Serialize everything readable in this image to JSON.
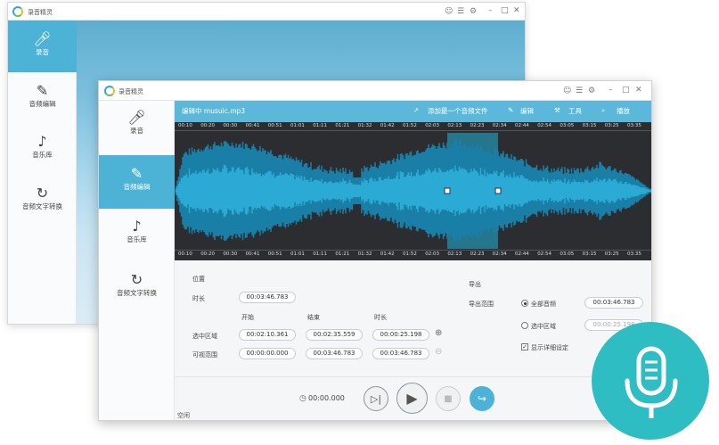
{
  "app": {
    "title": "录音精灵"
  },
  "back_window": {
    "sidebar": [
      {
        "label": "录音",
        "icon": "microphone-icon"
      },
      {
        "label": "音频编辑",
        "icon": "pencil-icon"
      },
      {
        "label": "音乐库",
        "icon": "music-list-icon"
      },
      {
        "label": "音频文字转换",
        "icon": "convert-icon"
      }
    ]
  },
  "sidebar": [
    {
      "label": "录音",
      "icon": "microphone-icon"
    },
    {
      "label": "音频编辑",
      "icon": "pencil-icon"
    },
    {
      "label": "音乐库",
      "icon": "music-list-icon"
    },
    {
      "label": "音频文字转换",
      "icon": "convert-icon"
    }
  ],
  "toolbar": {
    "file_label": "编辑中 musuic.mp3",
    "add_file": "添加最一个音频文件",
    "edit": "编辑",
    "tools": "工具",
    "playback": "播放"
  },
  "ruler_ticks": [
    "00:10",
    "00:20",
    "00:30",
    "00:41",
    "00:51",
    "01:01",
    "01:11",
    "01:21",
    "01:32",
    "01:42",
    "01:52",
    "02:03",
    "02:13",
    "02:23",
    "02:34",
    "02:44",
    "02:54",
    "03:05",
    "03:15",
    "03:25",
    "03:35"
  ],
  "position": {
    "label": "位置"
  },
  "duration": {
    "label": "时长",
    "value": "00:03:46.783"
  },
  "columns": {
    "start": "开始",
    "end": "结束",
    "length": "时长"
  },
  "selected_range": {
    "label": "选中区域",
    "start": "00:02:10.361",
    "end": "00:02:35.559",
    "length": "00:00:25.198"
  },
  "visible_range": {
    "label": "可视范围",
    "start": "00:00:00.000",
    "end": "00:03:46.783",
    "length": "00:03:46.783"
  },
  "export": {
    "label": "导出",
    "range_label": "导出范围",
    "all_audio": "全部音频",
    "all_value": "00:03:46.783",
    "selected_area": "选中区域",
    "selected_value": "00:00:25.198",
    "show_details": "显示详细设定"
  },
  "transport": {
    "time": "00:00.000"
  },
  "status": {
    "text": "空闲"
  },
  "colors": {
    "accent": "#4db3d6",
    "toolbar": "#5bb8da",
    "wave": "#1d8bb5",
    "badge": "#2fbdc4"
  }
}
